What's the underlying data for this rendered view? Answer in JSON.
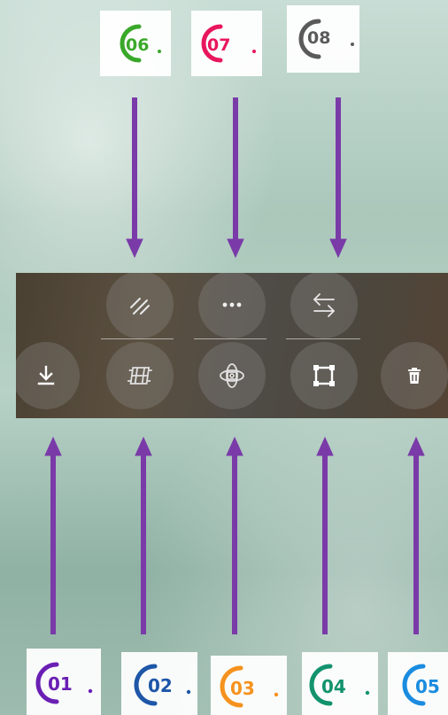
{
  "callouts_top": [
    {
      "number": "06",
      "color": "#3aa82a"
    },
    {
      "number": "07",
      "color": "#e8175d"
    },
    {
      "number": "08",
      "color": "#5a5a5a"
    }
  ],
  "callouts_bottom": [
    {
      "number": "01",
      "color": "#6a1fb4"
    },
    {
      "number": "02",
      "color": "#1e56a8"
    },
    {
      "number": "03",
      "color": "#f5921e"
    },
    {
      "number": "04",
      "color": "#12936e"
    },
    {
      "number": "05",
      "color": "#1a8ce0"
    }
  ],
  "arrow_color": "#7a3aa8",
  "toolbar": {
    "top_row": [
      "slash-lines-icon",
      "more-dots-icon",
      "swap-arrows-icon"
    ],
    "bottom_row": [
      "download-icon",
      "film-icon",
      "camera-orbit-icon",
      "transform-frame-icon",
      "trash-icon"
    ]
  }
}
